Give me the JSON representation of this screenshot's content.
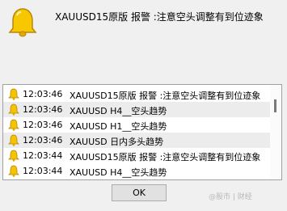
{
  "header": {
    "icon": "bell-icon",
    "message": "XAUUSD15原版  报警 :注意空头调整有到位迹象"
  },
  "alerts": [
    {
      "time": "12:03:46",
      "text": "XAUUSD15原版  报警 :注意空头调整有到位迹象"
    },
    {
      "time": "12:03:46",
      "text": "XAUUSD  H4__空头趋势"
    },
    {
      "time": "12:03:46",
      "text": "XAUUSD  H1__空头趋势"
    },
    {
      "time": "12:03:46",
      "text": "XAUUSD  日内多头趋势"
    },
    {
      "time": "12:03:44",
      "text": "XAUUSD15原版  报警 :注意空头调整有到位迹象"
    },
    {
      "time": "12:03:44",
      "text": "XAUUSD  H4__空头趋势"
    }
  ],
  "buttons": {
    "ok_label": "OK"
  },
  "watermark": "@股市 | 财经",
  "colors": {
    "bell": "#f5c400",
    "bell_outline": "#b8860b",
    "selected_row": "#ececec"
  }
}
